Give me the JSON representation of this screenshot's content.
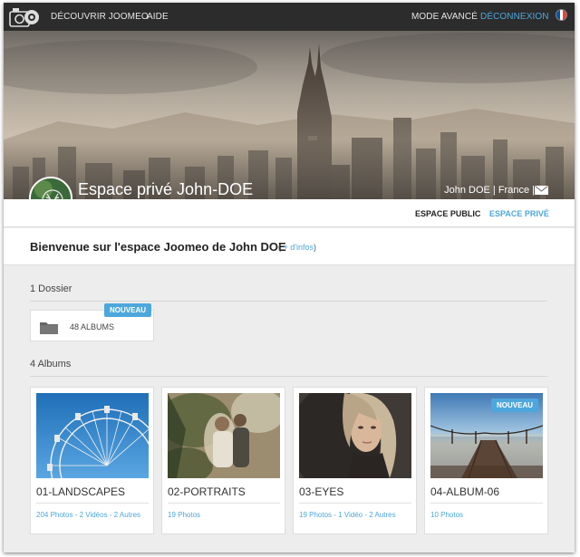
{
  "nav": {
    "discover": "DÉCOUVRIR JOOMEO",
    "help": "AIDE",
    "advanced_mode": "MODE AVANCÉ",
    "logout": "DÉCONNEXION",
    "flag_colors": [
      "#0055a4",
      "#ffffff",
      "#ef4135"
    ]
  },
  "header": {
    "space_title": "Espace privé John-DOE",
    "owner_line": "John DOE | France |"
  },
  "tabs": {
    "public": "ESPACE PUBLIC",
    "private": "ESPACE PRIVÉ"
  },
  "welcome": {
    "text": "Bienvenue sur l'espace Joomeo de John DOE",
    "more_open": "(",
    "more_link": "+ d'infos",
    "more_close": ")"
  },
  "folders": {
    "section_title": "1 Dossier",
    "items": [
      {
        "label": "48 ALBUMS",
        "badge": "NOUVEAU"
      }
    ]
  },
  "albums": {
    "section_title": "4 Albums",
    "items": [
      {
        "name": "01-LANDSCAPES",
        "meta": "204 Photos - 2 Vidéos - 2 Autres",
        "badge": ""
      },
      {
        "name": "02-PORTRAITS",
        "meta": "19 Photos",
        "badge": ""
      },
      {
        "name": "03-EYES",
        "meta": "19 Photos - 1 Vidéo - 2 Autres",
        "badge": ""
      },
      {
        "name": "04-ALBUM-06",
        "meta": "10 Photos",
        "badge": "NOUVEAU"
      }
    ]
  },
  "colors": {
    "accent": "#4ea7dc",
    "topbar": "#2c2c2c",
    "page_bg": "#ededed"
  }
}
